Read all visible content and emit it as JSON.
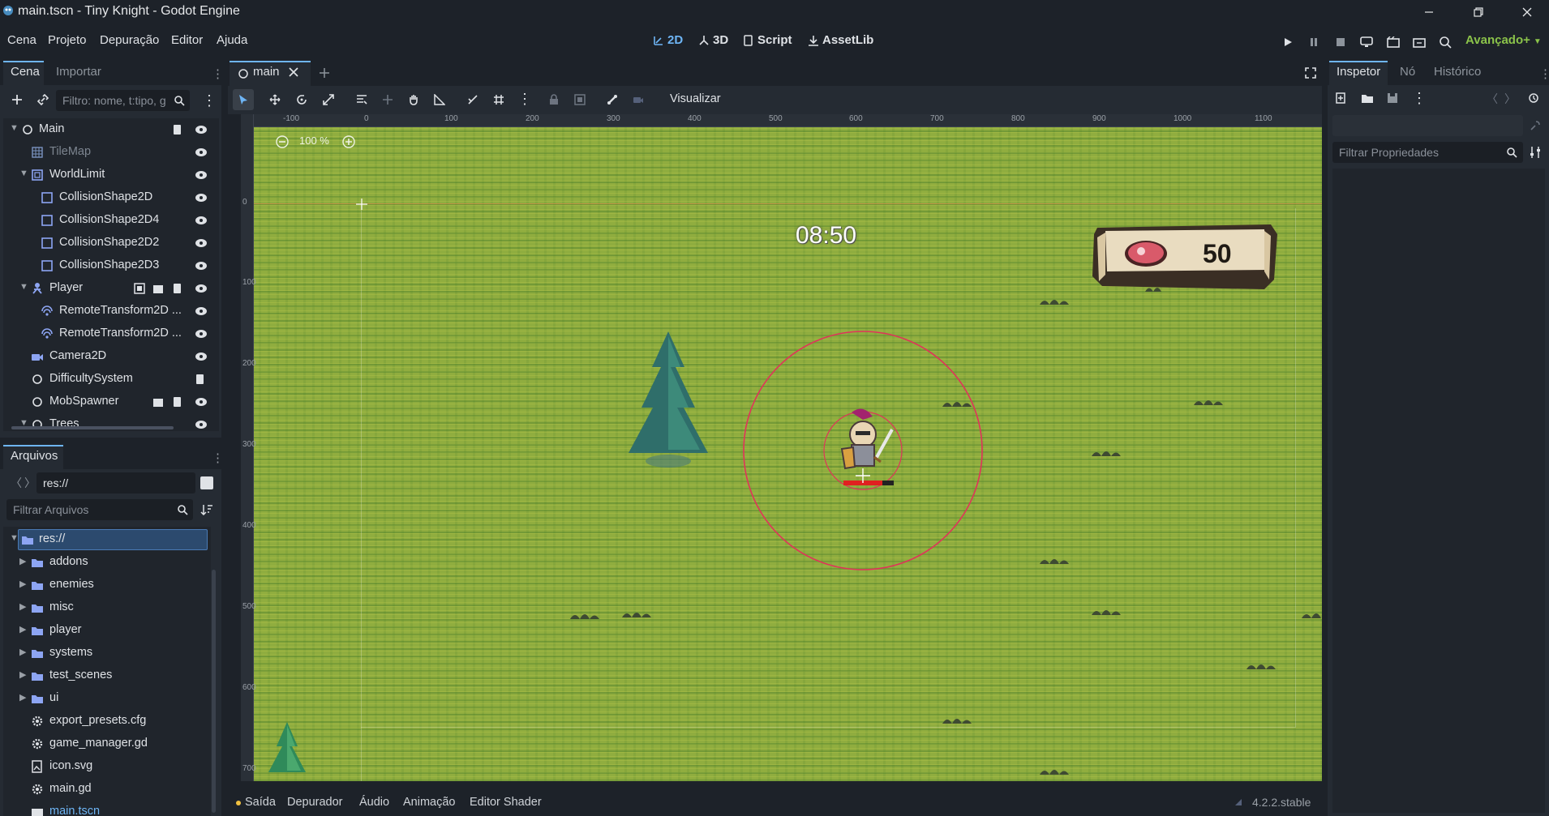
{
  "window": {
    "title": "main.tscn - Tiny Knight - Godot Engine"
  },
  "menu": {
    "items": [
      "Cena",
      "Projeto",
      "Depuração",
      "Editor",
      "Ajuda"
    ]
  },
  "modes": {
    "two_d": "2D",
    "three_d": "3D",
    "script": "Script",
    "assetlib": "AssetLib"
  },
  "renderer": "Avançado+",
  "scene_dock": {
    "tabs": [
      "Cena",
      "Importar"
    ],
    "filter_placeholder": "Filtro: nome, t:tipo, g",
    "tree": [
      {
        "label": "Main",
        "icon": "node-icon"
      },
      {
        "label": "TileMap",
        "icon": "tilemap-icon"
      },
      {
        "label": "WorldLimit",
        "icon": "static-body-icon"
      },
      {
        "label": "CollisionShape2D",
        "icon": "collision-shape-icon"
      },
      {
        "label": "CollisionShape2D4",
        "icon": "collision-shape-icon"
      },
      {
        "label": "CollisionShape2D2",
        "icon": "collision-shape-icon"
      },
      {
        "label": "CollisionShape2D3",
        "icon": "collision-shape-icon"
      },
      {
        "label": "Player",
        "icon": "character-body-icon"
      },
      {
        "label": "RemoteTransform2D ...",
        "icon": "remote-transform-icon"
      },
      {
        "label": "RemoteTransform2D ...",
        "icon": "remote-transform-icon"
      },
      {
        "label": "Camera2D",
        "icon": "camera-icon"
      },
      {
        "label": "DifficultySystem",
        "icon": "node-icon"
      },
      {
        "label": "MobSpawner",
        "icon": "node-icon"
      },
      {
        "label": "Trees",
        "icon": "node-icon"
      }
    ]
  },
  "filesystem_dock": {
    "title": "Arquivos",
    "path": "res://",
    "filter_placeholder": "Filtrar Arquivos",
    "tree": [
      {
        "label": "res://",
        "type": "folder"
      },
      {
        "label": "addons",
        "type": "folder"
      },
      {
        "label": "enemies",
        "type": "folder"
      },
      {
        "label": "misc",
        "type": "folder"
      },
      {
        "label": "player",
        "type": "folder"
      },
      {
        "label": "systems",
        "type": "folder"
      },
      {
        "label": "test_scenes",
        "type": "folder"
      },
      {
        "label": "ui",
        "type": "folder"
      },
      {
        "label": "export_presets.cfg",
        "type": "config"
      },
      {
        "label": "game_manager.gd",
        "type": "script"
      },
      {
        "label": "icon.svg",
        "type": "image"
      },
      {
        "label": "main.gd",
        "type": "script"
      },
      {
        "label": "main.tscn",
        "type": "scene"
      }
    ]
  },
  "editor": {
    "scene_tab": "main",
    "view_menu": "Visualizar",
    "zoom": "100 %",
    "ruler_h": [
      "-100",
      "0",
      "100",
      "200",
      "300",
      "400",
      "500",
      "600",
      "700",
      "800",
      "900",
      "1000",
      "1100"
    ],
    "ruler_v": [
      "0",
      "100",
      "200",
      "300",
      "400",
      "500",
      "600",
      "700"
    ]
  },
  "game": {
    "timer": "08:50",
    "meat_count": "50"
  },
  "inspector": {
    "tabs": [
      "Inspetor",
      "Nó",
      "Histórico"
    ],
    "filter_placeholder": "Filtrar Propriedades"
  },
  "bottom_panel": {
    "tabs": [
      "Saída",
      "Depurador",
      "Áudio",
      "Animação",
      "Editor Shader"
    ],
    "version": "4.2.2.stable"
  },
  "colors": {
    "accent": "#6eb5f5",
    "renderer": "#8bc34a",
    "selection": "#2c4a6e"
  }
}
